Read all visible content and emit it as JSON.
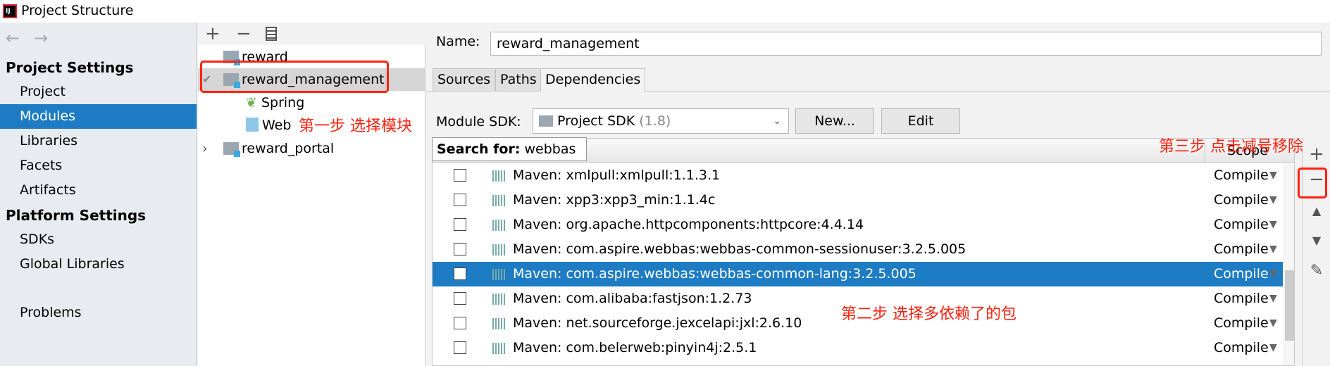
{
  "window": {
    "title": "Project Structure",
    "logo": "IJ"
  },
  "sidebar": {
    "back": "←",
    "forward": "→",
    "project_settings": "Project Settings",
    "project_items": [
      "Project",
      "Modules",
      "Libraries",
      "Facets",
      "Artifacts"
    ],
    "selected": "Modules",
    "platform_settings": "Platform Settings",
    "platform_items": [
      "SDKs",
      "Global Libraries"
    ],
    "problems": "Problems"
  },
  "tree": {
    "toolbar": {
      "add": "+",
      "remove": "−",
      "copy": "copy-icon"
    },
    "items": [
      "reward",
      "reward_management",
      "Spring",
      "Web",
      "reward_portal"
    ]
  },
  "module": {
    "name_label": "Name:",
    "name_value": "reward_management",
    "tabs": [
      "Sources",
      "Paths",
      "Dependencies"
    ],
    "active_tab": "Dependencies",
    "sdk_label": "Module SDK:",
    "sdk_value": "Project SDK",
    "sdk_version": "(1.8)",
    "new_button": "New...",
    "edit_button": "Edit",
    "search_label": "Search for:",
    "search_value": "webbas",
    "scope_header": "Scope",
    "dependencies": [
      {
        "name": "Maven: xmlpull:xmlpull:1.1.3.1",
        "scope": "Compile"
      },
      {
        "name": "Maven: xpp3:xpp3_min:1.1.4c",
        "scope": "Compile"
      },
      {
        "name": "Maven: org.apache.httpcomponents:httpcore:4.4.14",
        "scope": "Compile"
      },
      {
        "name": "Maven: com.aspire.webbas:webbas-common-sessionuser:3.2.5.005",
        "scope": "Compile"
      },
      {
        "name": "Maven: com.aspire.webbas:webbas-common-lang:3.2.5.005",
        "scope": "Compile"
      },
      {
        "name": "Maven: com.alibaba:fastjson:1.2.73",
        "scope": "Compile"
      },
      {
        "name": "Maven: net.sourceforge.jexcelapi:jxl:2.6.10",
        "scope": "Compile"
      },
      {
        "name": "Maven: com.belerweb:pinyin4j:2.5.1",
        "scope": "Compile"
      }
    ],
    "selected_index": 4
  },
  "annotations": {
    "step1": "第一步 选择模块",
    "step2": "第二步 选择多依赖了的包",
    "step3": "第三步 点击减号移除"
  },
  "colors": {
    "selection": "#1d7cc3",
    "annotation": "#ff2211"
  }
}
